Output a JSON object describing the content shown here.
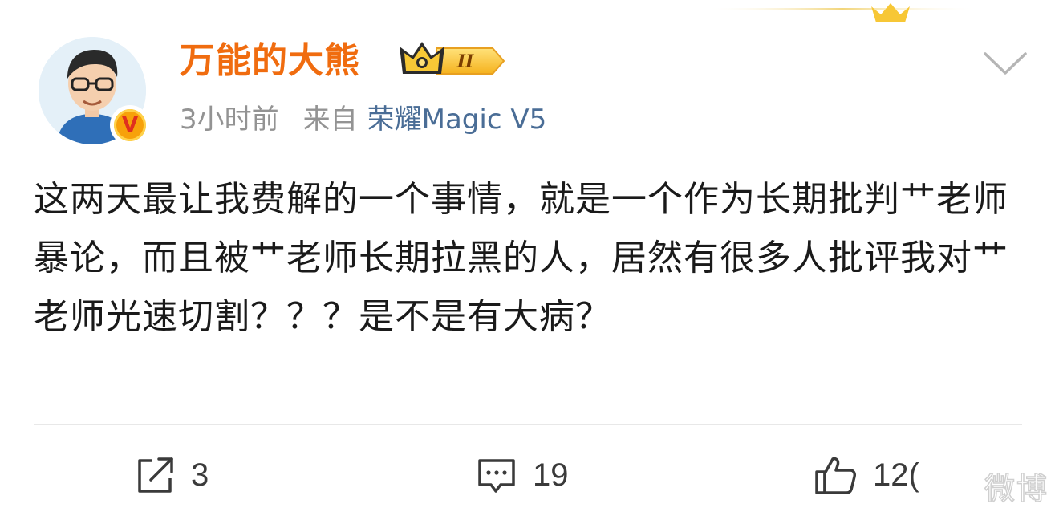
{
  "post": {
    "author": {
      "name": "万能的大熊",
      "level_label": "II",
      "verified_mark": "V"
    },
    "meta": {
      "time": "3小时前",
      "source_prefix": "来自",
      "device": "荣耀Magic V5"
    },
    "content": "这两天最让我费解的一个事情，就是一个作为长期批判艹老师暴论，而且被艹老师长期拉黑的人，居然有很多人批评我对艹老师光速切割？？？是不是有大病？"
  },
  "actions": {
    "repost_count": "3",
    "comment_count": "19",
    "like_count": "12("
  },
  "watermark": "微博"
}
